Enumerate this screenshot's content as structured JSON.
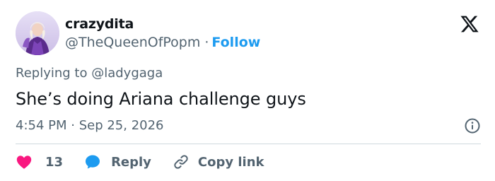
{
  "tweet": {
    "author": {
      "display_name": "crazydita",
      "handle": "@TheQueenOfPopm",
      "separator": "·",
      "follow_label": "Follow"
    },
    "replying_prefix": "Replying to",
    "replying_to": "@ladygaga",
    "text": "She’s doing Ariana challenge guys",
    "timestamp": "4:54 PM · Sep 25, 2026"
  },
  "actions": {
    "like_count": "13",
    "reply_label": "Reply",
    "copy_link_label": "Copy link"
  },
  "icons": {
    "logo": "x-logo",
    "info": "info-icon",
    "like": "heart-icon",
    "reply": "speech-bubble-icon",
    "copy": "link-icon"
  },
  "colors": {
    "accent": "#1d9bf0",
    "like": "#f91880",
    "text_primary": "#0f1419",
    "text_secondary": "#536471",
    "divider": "#cfd9de"
  }
}
